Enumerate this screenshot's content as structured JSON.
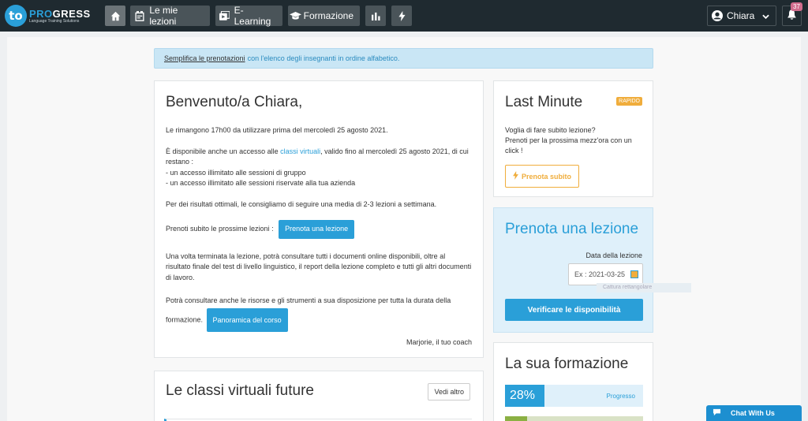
{
  "brand": {
    "logo_letters": "to",
    "name_part1": "PRO",
    "name_part2": "GRESS",
    "tagline": "Language Training Solutions"
  },
  "nav": {
    "items": [
      {
        "label": "",
        "icon": "home-icon"
      },
      {
        "label": "Le mie lezioni",
        "icon": "calendar-icon"
      },
      {
        "label": "E-Learning",
        "icon": "play-icon"
      },
      {
        "label": "Formazione",
        "icon": "graduation-cap-icon"
      },
      {
        "label": "",
        "icon": "bar-chart-icon"
      },
      {
        "label": "",
        "icon": "lightning-icon"
      }
    ],
    "user_name": "Chiara",
    "notification_count": "37"
  },
  "notice": {
    "link": "Semplifica le prenotazioni",
    "text": "con l'elenco degli insegnanti in ordine alfabetico."
  },
  "welcome": {
    "title": "Benvenuto/a Chiara,",
    "p1": "Le rimangono 17h00 da utilizzare prima del mercoledì 25 agosto 2021.",
    "p2_before": "È disponibile anche un accesso alle ",
    "p2_link": "classi virtuali",
    "p2_after": ", valido fino al mercoledì 25 agosto 2021, di cui restano :",
    "p2_line1": "- un accesso illimitato alle sessioni di gruppo",
    "p2_line2": "- un accesso illimitato alle sessioni riservate alla tua azienda",
    "p3": "Per dei risultati ottimali, le consigliamo di seguire una media di 2-3 lezioni a settimana.",
    "p4": "Prenoti subito le prossime lezioni :",
    "btn_prenota": "Prenota una lezione",
    "p5": "Una volta terminata la lezione, potrà consultare tutti i documenti online disponibili, oltre al risultato finale del test di livello linguistico, il report della lezione completo e tutti gli altri documenti di lavoro.",
    "p6": "Potrà consultare anche le risorse e gli strumenti a sua disposizione per tutta la durata della formazione.",
    "btn_panoramica": "Panoramica del corso",
    "signature": "Marjorie, il tuo coach"
  },
  "classi": {
    "title": "Le classi virtuali future",
    "btn_vedi": "Vedi altro"
  },
  "lastmin": {
    "title": "Last Minute",
    "badge": "RAPIDO",
    "line1": "Voglia di fare subito lezione?",
    "line2": "Prenoti per la prossima mezz'ora con un click !",
    "btn": "Prenota subito"
  },
  "prenota": {
    "title": "Prenota una lezione",
    "date_label": "Data della lezione",
    "date_placeholder": "Ex : 2021-03-25",
    "hint": "Cattura rettangolare",
    "btn": "Verificare le disponibilità"
  },
  "formazione": {
    "title": "La sua formazione",
    "progress_value": "28%",
    "progress_fraction": 0.28,
    "progress_label": "Progresso"
  },
  "chat": {
    "label": "Chat With Us"
  },
  "colors": {
    "accent": "#2a9fd8",
    "nav_bg": "#1f2a30",
    "orange": "#f0ad3c",
    "badge": "#d06b8c"
  }
}
